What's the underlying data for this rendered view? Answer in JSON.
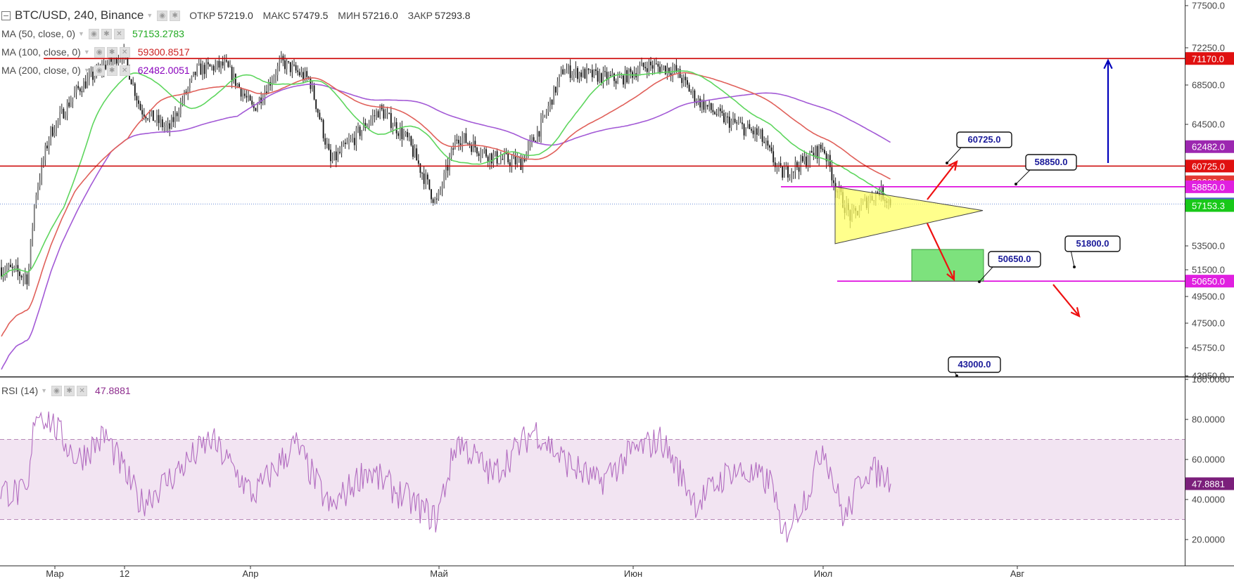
{
  "header": {
    "symbol": "BTC/USD, 240, Binance",
    "open_label": "ОТКР",
    "open_value": "57219.0",
    "high_label": "МАКС",
    "high_value": "57479.5",
    "low_label": "МИН",
    "low_value": "57216.0",
    "close_label": "ЗАКР",
    "close_value": "57293.8"
  },
  "indicators": [
    {
      "label": "MA (50, close, 0)",
      "value": "57153.2783",
      "color": "#22aa22"
    },
    {
      "label": "MA (100, close, 0)",
      "value": "59300.8517",
      "color": "#cc2222"
    },
    {
      "label": "MA (200, close, 0)",
      "value": "62482.0051",
      "color": "#8800bb"
    }
  ],
  "rsi": {
    "label": "RSI (14)",
    "value": "47.8881",
    "color": "#8d2c8d"
  },
  "colors": {
    "ma50": "#5ed65e",
    "ma100": "#e0605a",
    "ma200": "#a35ad6",
    "resistance": "#cc0000",
    "support": "#dd00dd",
    "triangle": "#ffff66",
    "target_box": "#66dd66",
    "arrow_up": "#0000bb",
    "arrow_down": "#ee1111",
    "candle": "#222222",
    "rsi_line": "#b26cc0",
    "rsi_band": "#f2e4f2"
  },
  "chart_data": [
    {
      "type": "candlestick",
      "title": "BTC/USD, 240, Binance",
      "x_ticks": [
        "Мар",
        "12",
        "Апр",
        "Май",
        "Июн",
        "Июл",
        "Авг"
      ],
      "y_ticks": [
        "77500.0",
        "72250.0",
        "68500.0",
        "64500.0",
        "53500.0",
        "51500.0",
        "49500.0",
        "47500.0",
        "45750.0",
        "43950.0"
      ],
      "y_range": [
        43950,
        77500
      ],
      "price_labels": [
        {
          "value": 71170.0,
          "text": "71170.0",
          "color": "#e01010"
        },
        {
          "value": 62482.0,
          "text": "62482.0",
          "color": "#9c27b0"
        },
        {
          "value": 60725.0,
          "text": "60725.0",
          "color": "#e01010"
        },
        {
          "value": 59300.9,
          "text": "59300.9",
          "color": "#e53935"
        },
        {
          "value": 58850.0,
          "text": "58850.0",
          "color": "#e020e0"
        },
        {
          "value": 57293.8,
          "text": "57293.8",
          "color": "#4a63c9"
        },
        {
          "value": 57153.3,
          "text": "57153.3",
          "color": "#18c818"
        },
        {
          "value": 50650.0,
          "text": "50650.0",
          "color": "#e020e0"
        }
      ],
      "horizontal_lines": [
        {
          "value": 71170.0,
          "kind": "resistance"
        },
        {
          "value": 60725.0,
          "kind": "resistance"
        },
        {
          "value": 58850.0,
          "kind": "support"
        },
        {
          "value": 50650.0,
          "kind": "support"
        },
        {
          "value": 57293.8,
          "kind": "last-price"
        }
      ],
      "annotations": [
        "60725.0",
        "58850.0",
        "50650.0",
        "51800.0",
        "43000.0"
      ]
    },
    {
      "type": "line",
      "title": "RSI (14)",
      "y_ticks": [
        "100.0000",
        "80.0000",
        "60.0000",
        "40.0000",
        "20.0000"
      ],
      "y_range": [
        10,
        100
      ],
      "band": [
        30,
        70
      ],
      "last_value": 47.8881
    }
  ]
}
